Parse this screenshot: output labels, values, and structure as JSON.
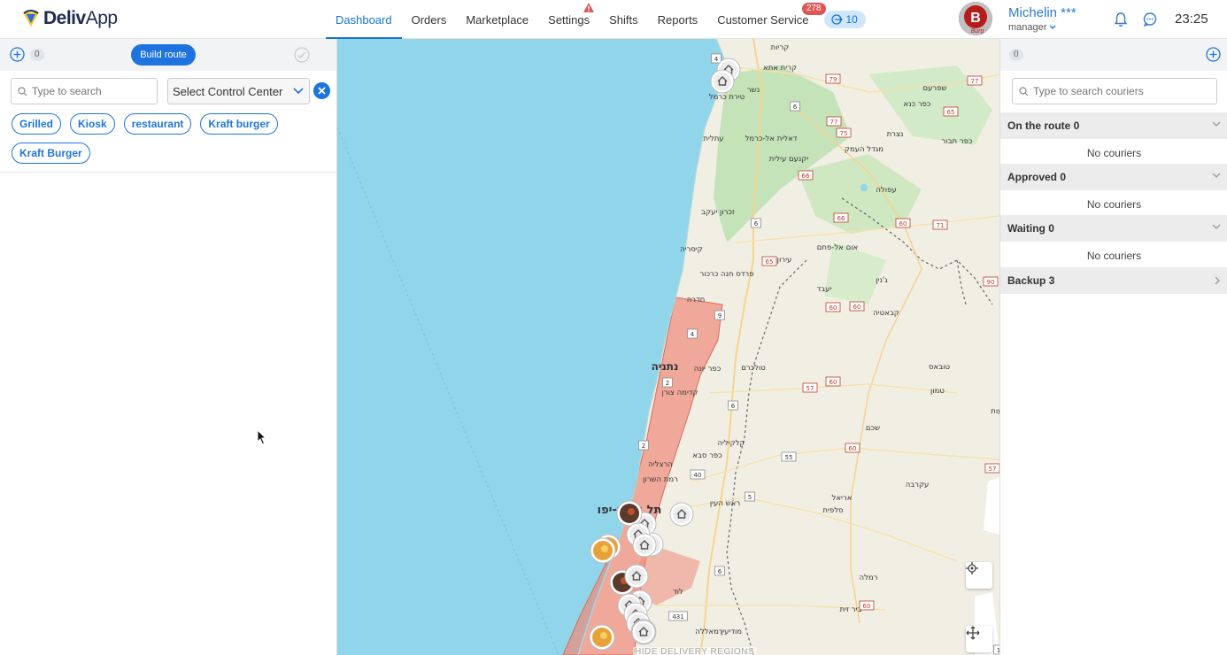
{
  "brand": {
    "name_bold": "Deliv",
    "name_rest": "App"
  },
  "nav": {
    "items": [
      {
        "label": "Dashboard",
        "active": true
      },
      {
        "label": "Orders"
      },
      {
        "label": "Marketplace"
      },
      {
        "label": "Settings",
        "warning": true
      },
      {
        "label": "Shifts"
      },
      {
        "label": "Reports"
      },
      {
        "label": "Customer Service",
        "badge": "278"
      }
    ],
    "pill_count": "10"
  },
  "user": {
    "name": "Michelin ***",
    "role": "manager",
    "avatar_letter": "B",
    "avatar_caption": "Burg"
  },
  "clock": "23:25",
  "left_panel": {
    "count": "0",
    "build_route_label": "Build route",
    "search_placeholder": "Type to search",
    "control_center_placeholder": "Select Control Center",
    "tags": [
      "Grilled",
      "Kiosk",
      "restaurant",
      "Kraft burger",
      "Kraft Burger"
    ]
  },
  "map": {
    "hide_regions_label": "HIDE DELIVERY REGIONS",
    "place_labels": [
      "קריות",
      "קרית אתא",
      "נשר",
      "טירת כרמל",
      "שפרעם",
      "כפר כנא",
      "עתלית",
      "דאלית אל-כרמל",
      "נצרת",
      "יקנעם עילית",
      "מגדל העמק",
      "כפר תבור",
      "עפולה",
      "זכרון יעקב",
      "קיסריה",
      "אום אל-פחם",
      "עירון",
      "פרדס חנה כרכור",
      "חדרה",
      "יעבד",
      "ג'נין",
      "קבאטיה",
      "נתניה",
      "כפר יונה",
      "טולכרם",
      "טובאס",
      "קדימה צורן",
      "טמון",
      "קלקיליה",
      "כפר סבא",
      "הרצליה",
      "רמת השרון",
      "שכם",
      "ראש העין",
      "אריאל",
      "סלפית",
      "עקרבה",
      "תל אביב-יפו",
      "לוד",
      "רמלה",
      "ביר זית",
      "רמאללה",
      "מודיעין",
      "מכבים רעות",
      "רוגי"
    ],
    "road_numbers": [
      "4",
      "79",
      "77",
      "6",
      "65",
      "77",
      "75",
      "66",
      "6",
      "66",
      "60",
      "71",
      "65",
      "60",
      "90",
      "9",
      "4",
      "60",
      "57",
      "60",
      "2",
      "6",
      "55",
      "60",
      "57",
      "40",
      "2",
      "5",
      "6",
      "60",
      "431",
      "1"
    ],
    "marker_icons": [
      "home-marker-icon",
      "restaurant-marker-icon",
      "food-marker-icon"
    ]
  },
  "right_panel": {
    "count": "0",
    "search_placeholder": "Type to search couriers",
    "groups": [
      {
        "title": "On the route 0",
        "empty_label": "No couriers"
      },
      {
        "title": "Approved 0",
        "empty_label": "No couriers"
      },
      {
        "title": "Waiting 0",
        "empty_label": "No couriers"
      },
      {
        "title": "Backup 3"
      }
    ]
  },
  "colors": {
    "accent": "#1e74de",
    "nav_active": "#1673d6",
    "sea": "#90d5ea",
    "land": "#f1efe4",
    "region": "#ee8a7a",
    "badge": "#e25555"
  }
}
